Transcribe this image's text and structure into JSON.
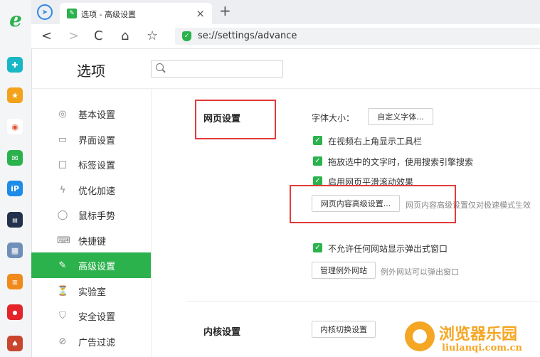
{
  "browser": {
    "tab_title": "选项 - 高级设置",
    "tab_close": "×",
    "new_tab": "+",
    "url": "se://settings/advance",
    "back": "<",
    "forward": ">",
    "reload": "C",
    "home": "⌂",
    "star": "☆"
  },
  "left_sidebar_apps": [
    "plus-app-icon",
    "star-app-icon",
    "weibo-icon",
    "mail-icon",
    "ip-app-icon",
    "news-app-icon",
    "doc-app-icon",
    "novel-app-icon",
    "red-app-icon",
    "game-app-icon"
  ],
  "page": {
    "title": "选项",
    "search_placeholder": ""
  },
  "menu": [
    {
      "label": "基本设置",
      "icon": "◎"
    },
    {
      "label": "界面设置",
      "icon": "▭"
    },
    {
      "label": "标签设置",
      "icon": "□"
    },
    {
      "label": "优化加速",
      "icon": "ϟ"
    },
    {
      "label": "鼠标手势",
      "icon": "◯"
    },
    {
      "label": "快捷键",
      "icon": "⌨"
    },
    {
      "label": "高级设置",
      "icon": "✎",
      "active": true
    },
    {
      "label": "实验室",
      "icon": "⏳"
    },
    {
      "label": "安全设置",
      "icon": "⛉"
    },
    {
      "label": "广告过滤",
      "icon": "⊘"
    }
  ],
  "webpage_section": {
    "label": "网页设置",
    "font_size_label": "字体大小：",
    "custom_font_button": "自定义字体...",
    "options": [
      "在视频右上角显示工具栏",
      "拖放选中的文字时，使用搜索引擎搜索",
      "启用网页平滑滚动效果"
    ],
    "advanced_button": "网页内容高级设置...",
    "advanced_hint": "网页内容高级设置仅对极速模式生效",
    "popup_option": "不允许任何网站显示弹出式窗口",
    "exceptions_button": "管理例外网站",
    "exceptions_hint": "例外网站可以弹出窗口"
  },
  "kernel_section": {
    "label": "内核设置",
    "switch_button": "内核切换设置"
  },
  "watermark": {
    "title": "浏览器乐园",
    "url": "liulanqi.com.cn"
  },
  "colors": {
    "accent": "#2bb24c",
    "highlight": "#e33b3b"
  }
}
